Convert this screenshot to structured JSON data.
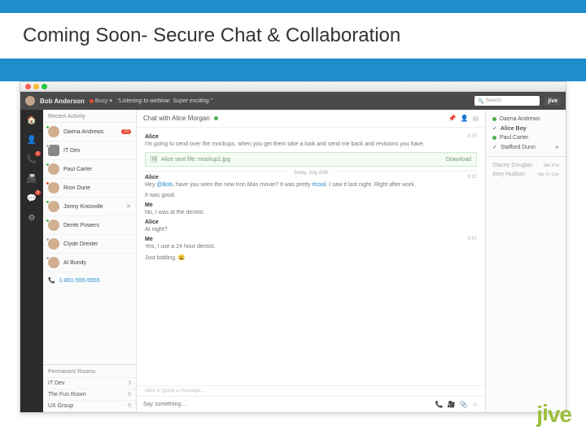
{
  "slide": {
    "title": "Coming Soon- Secure Chat & Collaboration"
  },
  "topbar": {
    "user": "Bob Anderson",
    "status": "Busy",
    "status_msg": "\"Listening to webinar. Super exciting.\"",
    "search_placeholder": "Search",
    "logo": "jive"
  },
  "rail": {
    "chat_badge": "3",
    "phone_badge": "1"
  },
  "recent": {
    "header": "Recent Activity",
    "contacts": [
      {
        "name": "Daena Andrews",
        "presence": "green",
        "badge": "13"
      },
      {
        "name": "IT Dev",
        "presence": "grey",
        "icon": "group"
      },
      {
        "name": "Paul Carter",
        "presence": "green"
      },
      {
        "name": "Rion Dune",
        "presence": "red"
      },
      {
        "name": "Jonny Knoxville",
        "presence": "green",
        "close": true
      },
      {
        "name": "Derek Powers",
        "presence": "green"
      },
      {
        "name": "Clyde Drexler",
        "presence": "grey"
      },
      {
        "name": "Al Bundy",
        "presence": "grey"
      }
    ],
    "phone": "1-801-555-5555",
    "perm_header": "Permanent Rooms",
    "rooms": [
      {
        "name": "IT Dev",
        "count": "3"
      },
      {
        "name": "The Fun Room",
        "count": "5"
      },
      {
        "name": "UX Group",
        "count": "5"
      }
    ]
  },
  "chat": {
    "title": "Chat with Alice Morgan",
    "messages": [
      {
        "who": "Alice",
        "body": "I'm going to send over the mockups, when you get them take a look and send me back and revisions you have.",
        "time": "4:56"
      }
    ],
    "file": {
      "label": "Alice sent file: mockup1.jpg",
      "action": "Download"
    },
    "date": "Today, July 20th",
    "messages2": [
      {
        "who": "Alice",
        "body_pre": "Hey ",
        "mention": "@Bob",
        "body_mid": ", have you seen the new Iron Man movie? It was pretty ",
        "hashtag": "#cool",
        "body_post": ". I saw it last night. Right after work.",
        "time": "9:32"
      },
      {
        "who": "",
        "body": "It was good."
      },
      {
        "who": "Me",
        "body": "No, I was at the dentist."
      },
      {
        "who": "Alice",
        "body": "At night?"
      },
      {
        "who": "Me",
        "body": "Yes, I use a 24 hour dentist.",
        "time": "9:41"
      },
      {
        "who": "",
        "body": "Just kidding. 😄"
      }
    ],
    "typing": "Alice is typing a message…",
    "compose_placeholder": "Say something…"
  },
  "presence": {
    "items": [
      {
        "name": "Daena Andrews",
        "online": true
      },
      {
        "name": "Alice Boy",
        "online": true,
        "checked": true
      },
      {
        "name": "Paul Carter",
        "online": true
      },
      {
        "name": "Stafford Dunn",
        "online": true,
        "checked": true
      }
    ],
    "away": [
      {
        "name": "Stacey Douglas",
        "ago": "Idle 37m"
      },
      {
        "name": "Amy Hudson",
        "ago": "Idle 1h 13m"
      }
    ]
  },
  "logo": "jive"
}
